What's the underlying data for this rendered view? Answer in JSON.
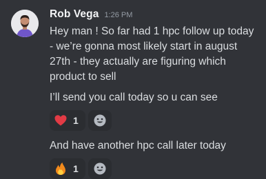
{
  "message": {
    "author": "Rob Vega",
    "timestamp": "1:26 PM",
    "avatar_bg": "#e9e9ec",
    "shirt_color": "#6f56c9"
  },
  "messages": [
    {
      "text": "Hey man ! So far had 1 hpc follow up today\n- we’re gonna most likely start in august\n27th - they actually are figuring which\nproduct to sell"
    },
    {
      "text": "I’ll send you call today so u can see",
      "reactions": [
        {
          "emoji": "heart-icon",
          "count": "1",
          "color": "#e23b45"
        }
      ]
    },
    {
      "text": "And have another hpc call later today",
      "reactions": [
        {
          "emoji": "fire-icon",
          "count": "1",
          "color": "#f28a1c"
        }
      ]
    }
  ],
  "add_reaction_icon": "smiley-icon"
}
